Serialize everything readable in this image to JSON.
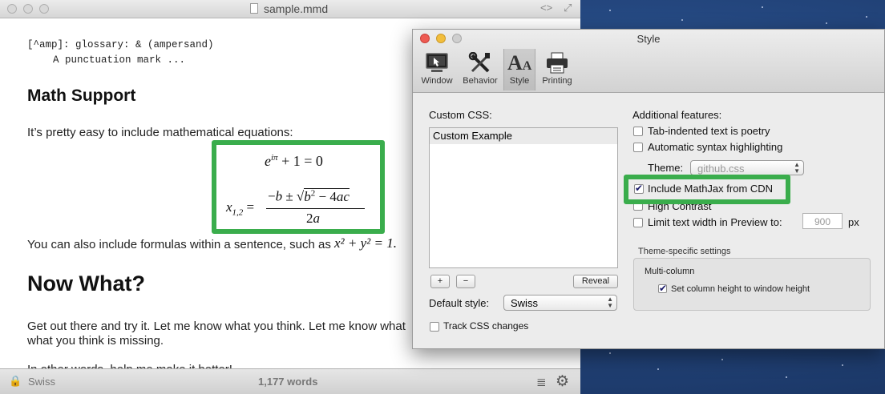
{
  "editor": {
    "title": "sample.mmd",
    "lines": {
      "glossary_def": "[^amp]: glossary: & (ampersand)",
      "glossary_desc": "A punctuation mark ...",
      "math_heading": "Math Support",
      "math_intro": "It’s pretty easy to include mathematical equations:",
      "inline_text": "You can also include formulas within a sentence, such as",
      "inline_formula": "x² + y² = 1.",
      "now_heading": "Now What?",
      "para1": "Get out there and try it. Let me know what you think. Let me know what",
      "para2": "what you think is missing.",
      "para3": "In other words, help me make it better!"
    },
    "equation1": "e^{iπ} + 1 = 0",
    "equation2": "x_{1,2} = (−b ± √(b² − 4ac)) / 2a",
    "status": {
      "style": "Swiss",
      "word_count": "1,177 words"
    }
  },
  "style_window": {
    "title": "Style",
    "toolbar": [
      {
        "label": "Window",
        "icon": "window-icon"
      },
      {
        "label": "Behavior",
        "icon": "tools-icon"
      },
      {
        "label": "Style",
        "icon": "font-style-icon",
        "selected": true
      },
      {
        "label": "Printing",
        "icon": "printer-icon"
      }
    ],
    "custom_css_label": "Custom CSS:",
    "css_list": [
      "Custom Example"
    ],
    "add_label": "+",
    "remove_label": "−",
    "reveal_label": "Reveal",
    "default_style_label": "Default style:",
    "default_style_value": "Swiss",
    "track_css_label": "Track CSS changes",
    "additional_label": "Additional features:",
    "options": {
      "poetry": "Tab-indented text is poetry",
      "syntax": "Automatic syntax highlighting",
      "theme_label": "Theme:",
      "theme_value": "github.css",
      "mathjax": "Include MathJax from CDN",
      "high_contrast": "High Contrast",
      "limit_width": "Limit text width in Preview to:",
      "limit_value": "900",
      "limit_unit": "px"
    },
    "theme_settings_label": "Theme-specific settings",
    "multicolumn_label": "Multi-column",
    "column_height_label": "Set column height to window height"
  },
  "colors": {
    "highlight": "#3aad4c"
  }
}
